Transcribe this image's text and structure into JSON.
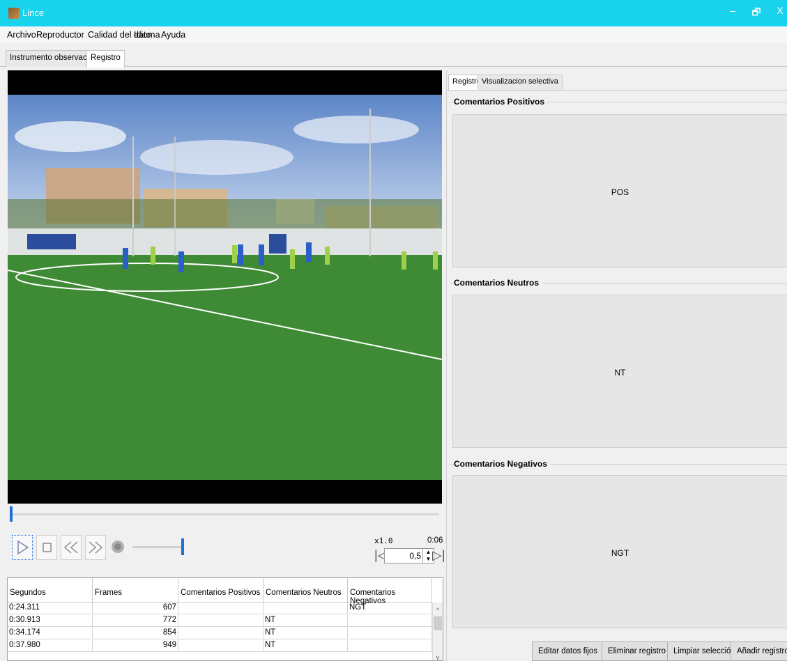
{
  "window": {
    "title": "Lince",
    "minimize": "–",
    "restore": "🗗",
    "close": "X"
  },
  "menu": [
    "Archivo",
    "Reproductor",
    "Calidad del dato",
    "Idioma",
    "Ayuda"
  ],
  "main_tabs": [
    {
      "label": "Instrumento observacional",
      "active": false
    },
    {
      "label": "Registro",
      "active": true
    }
  ],
  "player": {
    "progress": 0.0,
    "volume": 1.0,
    "speed": "x1.0",
    "time": "0:06",
    "step": "0,5",
    "icons": [
      "play-icon",
      "stop-icon",
      "rewind-icon",
      "fast-forward-icon",
      "volume-icon",
      "skip-start-icon",
      "skip-end-icon"
    ]
  },
  "table": {
    "columns": [
      "Segundos",
      "Frames",
      "Comentarios Positivos",
      "Comentarios Neutros",
      "Comentarios Negativos"
    ],
    "rows": [
      [
        "0:24.311",
        "607",
        "",
        "",
        "NGT"
      ],
      [
        "0:30.913",
        "772",
        "",
        "NT",
        ""
      ],
      [
        "0:34.174",
        "854",
        "",
        "NT",
        ""
      ],
      [
        "0:37.980",
        "949",
        "",
        "NT",
        ""
      ]
    ],
    "scroll_up": "^",
    "scroll_down": "v"
  },
  "right_tabs": [
    {
      "label": "Registro",
      "active": true
    },
    {
      "label": "Visualizacion selectiva",
      "active": false
    }
  ],
  "groups": [
    {
      "title": "Comentarios Positivos",
      "value": "POS"
    },
    {
      "title": "Comentarios Neutros",
      "value": "NT"
    },
    {
      "title": "Comentarios Negativos",
      "value": "NGT"
    }
  ],
  "buttons": {
    "edit": "Editar datos fijos",
    "delete": "Eliminar registro",
    "clear": "Limpiar selección",
    "add": "Añadir registro"
  },
  "colors": {
    "titlebar": "#18d3eb",
    "accent": "#1d6fd6",
    "grass": "#3f8a34"
  }
}
